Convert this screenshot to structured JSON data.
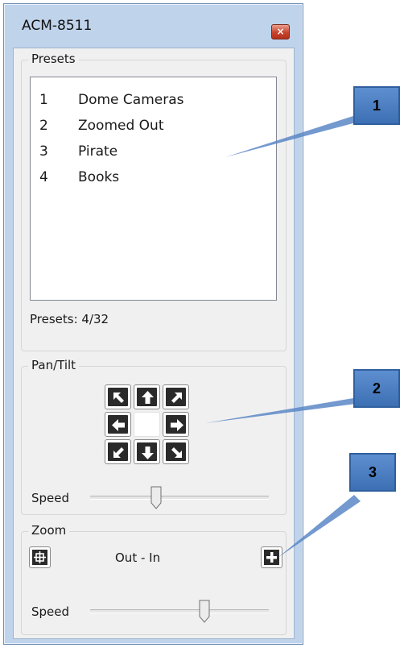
{
  "window": {
    "title": "ACM-8511",
    "close_glyph": "×"
  },
  "presets": {
    "group_label": "Presets",
    "items": [
      {
        "num": "1",
        "name": "Dome Cameras"
      },
      {
        "num": "2",
        "name": "Zoomed Out"
      },
      {
        "num": "3",
        "name": "Pirate"
      },
      {
        "num": "4",
        "name": "Books"
      }
    ],
    "count_text": "Presets:  4/32"
  },
  "pan_tilt": {
    "group_label": "Pan/Tilt",
    "speed_label": "Speed",
    "speed_value": 0.37,
    "buttons": [
      "up-left-icon",
      "up-icon",
      "up-right-icon",
      "left-icon",
      "right-icon",
      "down-left-icon",
      "down-icon",
      "down-right-icon"
    ]
  },
  "zoom": {
    "group_label": "Zoom",
    "range_text": "Out - In",
    "speed_label": "Speed",
    "speed_value": 0.64,
    "out_icon": "zoom-out-crosshair-icon",
    "in_icon": "zoom-in-plus-icon"
  },
  "callouts": [
    "1",
    "2",
    "3"
  ],
  "colors": {
    "window_frame": "#bfd3ea",
    "close_button": "#c8432c",
    "callout": "#4a7dc2"
  }
}
